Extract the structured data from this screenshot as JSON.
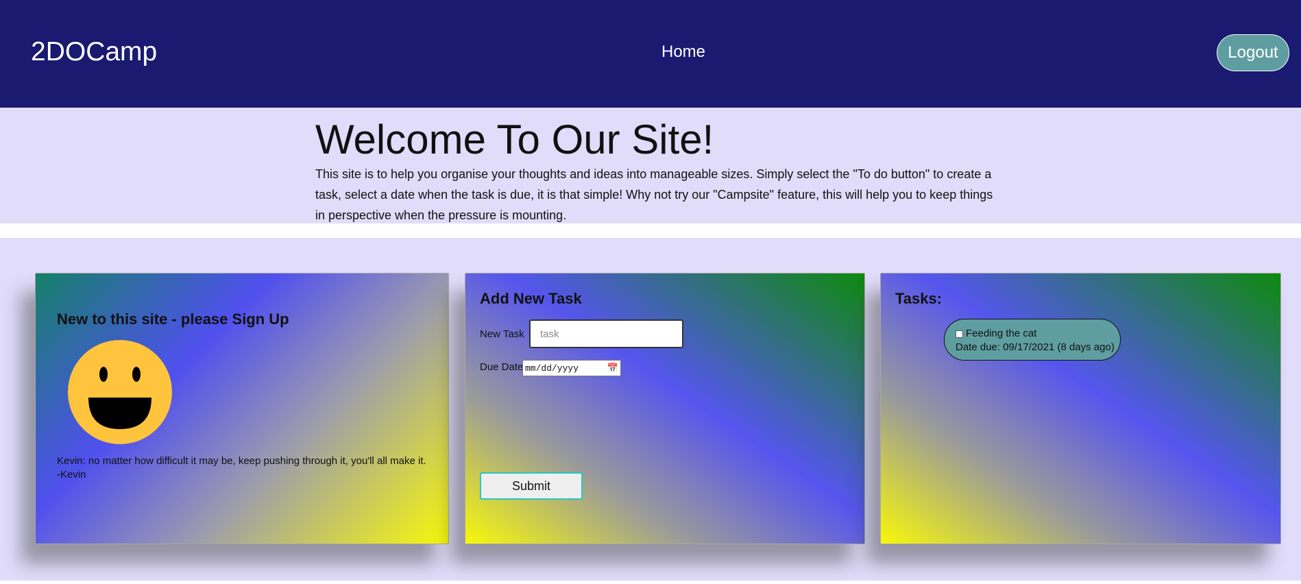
{
  "header": {
    "brand": "2DOCamp",
    "nav_home": "Home",
    "logout_label": "Logout"
  },
  "hero": {
    "title": "Welcome To Our Site!",
    "description": "This site is to help you organise your thoughts and ideas into manageable sizes. Simply select the \"To do button\" to create a task, select a date when the task is due, it is that simple! Why not try our \"Campsite\" feature, this will help you to keep things in perspective when the pressure is mounting."
  },
  "signup_card": {
    "title": "New to this site - please Sign Up",
    "quote": "Kevin: no matter how difficult it may be, keep pushing through it, you'll all make it. -Kevin",
    "icon": "smiley-face-icon"
  },
  "add_task_card": {
    "title": "Add New Task",
    "new_task_label": "New Task",
    "new_task_placeholder": "task",
    "new_task_value": "",
    "due_date_label": "Due Date",
    "due_date_placeholder": "mm/dd/yyyy",
    "submit_label": "Submit"
  },
  "tasks_card": {
    "title": "Tasks:",
    "items": [
      {
        "name": "Feeding the cat",
        "due": "Date due: 09/17/2021 (8 days ago)",
        "checked": false
      }
    ]
  },
  "colors": {
    "navbar": "#1a1a71",
    "page_background": "#e0dcfa",
    "accent_teal": "#5f9ea0",
    "smiley_yellow": "#ffc43d"
  }
}
